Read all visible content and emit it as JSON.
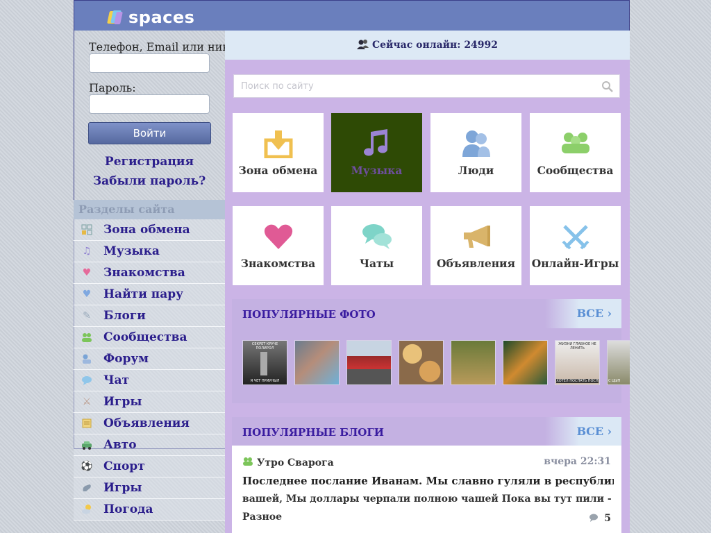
{
  "header": {
    "logo_text": "spaces"
  },
  "login": {
    "phone_label": "Телефон, Email или ник",
    "password_label": "Пароль:",
    "login_button": "Войти",
    "register_link": "Регистрация",
    "forgot_link": "Забыли пароль?"
  },
  "sections": {
    "title": "Разделы сайта",
    "items": [
      {
        "label": "Зона обмена",
        "icon": "grid-icon"
      },
      {
        "label": "Музыка",
        "icon": "music-note-icon"
      },
      {
        "label": "Знакомства",
        "icon": "heart-icon"
      },
      {
        "label": "Найти пару",
        "icon": "broken-heart-icon"
      },
      {
        "label": "Блоги",
        "icon": "pen-icon"
      },
      {
        "label": "Сообщества",
        "icon": "group-icon"
      },
      {
        "label": "Форум",
        "icon": "forum-icon"
      },
      {
        "label": "Чат",
        "icon": "chat-bubble-icon"
      },
      {
        "label": "Игры",
        "icon": "swords-icon"
      },
      {
        "label": "Объявления",
        "icon": "board-icon"
      },
      {
        "label": "Авто",
        "icon": "car-icon"
      },
      {
        "label": "Спорт",
        "icon": "ball-icon"
      },
      {
        "label": "Игры",
        "icon": "gamepad-icon"
      },
      {
        "label": "Погода",
        "icon": "weather-icon"
      }
    ]
  },
  "online": {
    "text": "Сейчас онлайн: 24992"
  },
  "search": {
    "placeholder": "Поиск по сайту"
  },
  "tiles": [
    {
      "label": "Зона обмена",
      "icon": "download-box-icon",
      "color": "#f0c050"
    },
    {
      "label": "Музыка",
      "icon": "music-note-icon",
      "color": "#9b84d4",
      "bg": "#2e4a05"
    },
    {
      "label": "Люди",
      "icon": "people-icon",
      "color": "#7ea6d8"
    },
    {
      "label": "Сообщества",
      "icon": "community-icon",
      "color": "#8ccf6a"
    },
    {
      "label": "Знакомства",
      "icon": "heart-icon",
      "color": "#e05a95"
    },
    {
      "label": "Чаты",
      "icon": "chat-bubbles-icon",
      "color": "#7ed4c8"
    },
    {
      "label": "Объявления",
      "icon": "megaphone-icon",
      "color": "#d9b46a"
    },
    {
      "label": "Онлайн-Игры",
      "icon": "crossed-swords-icon",
      "color": "#86c2ea"
    }
  ],
  "popular_photos": {
    "title": "ПОПУЛЯРНЫЕ ФОТО",
    "all_link": "ВСЕ",
    "thumbs": [
      {
        "caption_top": "СЕКРЕТ КРУЧЕ ПОЛИРОЛ",
        "caption_bottom": "Я ЧЕТ ПРИУНЫЛ"
      },
      {
        "caption_top": "",
        "caption_bottom": ""
      },
      {
        "caption_top": "",
        "caption_bottom": ""
      },
      {
        "caption_top": "",
        "caption_bottom": ""
      },
      {
        "caption_top": "",
        "caption_bottom": ""
      },
      {
        "caption_top": "",
        "caption_bottom": ""
      },
      {
        "caption_top": "ЖИЗНИ ГЛАВНОЕ НЕ ЛЕНИТЬ",
        "caption_bottom": "ХОТЕЛ ПОСПАТЬ ПОСЛ"
      },
      {
        "caption_top": "",
        "caption_bottom": "С ЦЫП"
      }
    ]
  },
  "popular_blogs": {
    "title": "ПОПУЛЯРНЫЕ БЛОГИ",
    "all_link": "ВСЕ",
    "post": {
      "author": "Утро Сварога",
      "time": "вчера 22:31",
      "title": "Последнее послание Иванам. Мы славно гуляли в республике…",
      "excerpt": "вашей, Мы доллары черпали полною чашей Пока вы тут пили - м…",
      "category": "Разное",
      "comments": "5"
    }
  }
}
